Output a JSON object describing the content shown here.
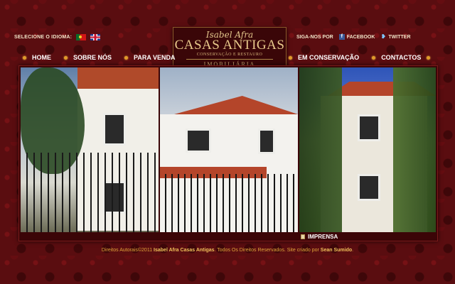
{
  "header": {
    "language_label": "SELECIONE O IDIOMA:",
    "languages": [
      "pt-flag-icon",
      "uk-flag-icon"
    ],
    "follow_label": "SIGA-NOS POR",
    "facebook_label": "FACEBOOK",
    "twitter_label": "TWITTER"
  },
  "logo": {
    "script": "Isabel Afra",
    "main": "CASAS ANTIGAS",
    "sub": "CONSERVAÇÃO E RESTAURO",
    "bottom": "IMOBILIÁRIA"
  },
  "nav": {
    "left": [
      "HOME",
      "SOBRE NÓS",
      "PARA VENDA"
    ],
    "right": [
      "EM CONSERVAÇÃO",
      "CONTACTOS"
    ]
  },
  "panel": {
    "press_label": "IMPRENSA"
  },
  "footer": {
    "prefix": "Direitos Autorais©2011",
    "company": "Isabel Afra Casas Antigas",
    "middle": ". Todos Os Direitos Reservados. Site criado por",
    "author": "Sean Sumido",
    "suffix": "."
  },
  "colors": {
    "background": "#5a0d10",
    "accent": "#e0a43a",
    "gold": "#e8c98b"
  }
}
